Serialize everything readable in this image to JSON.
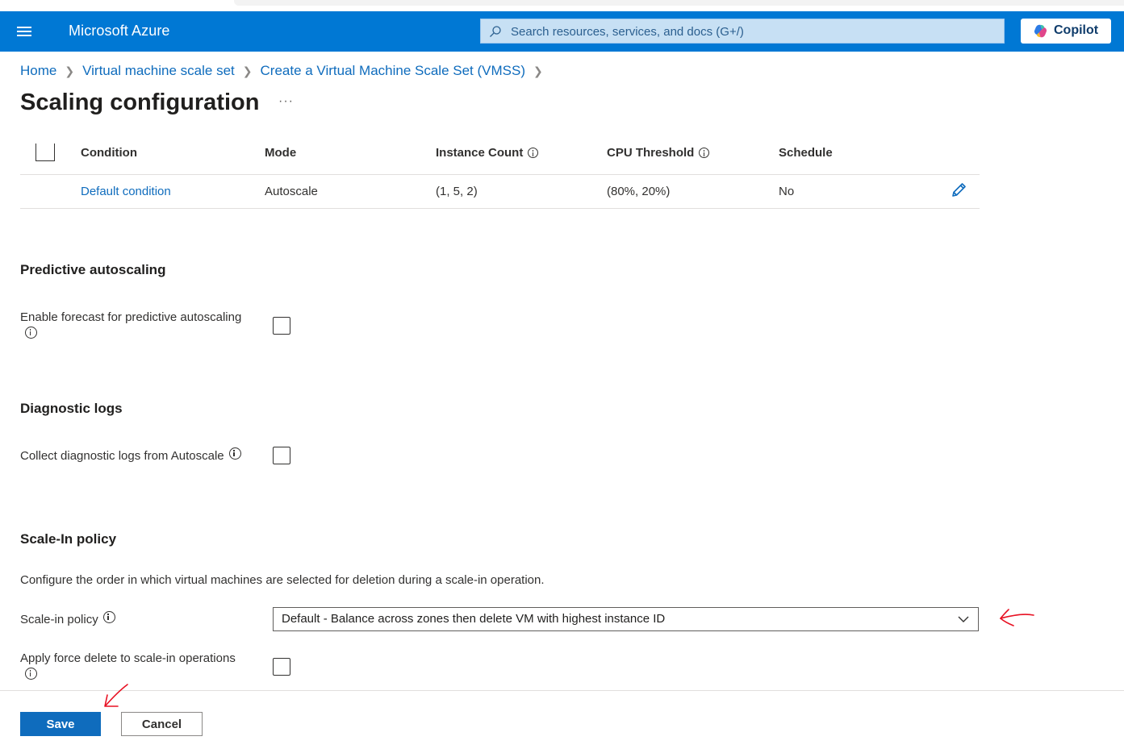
{
  "header": {
    "brand": "Microsoft Azure",
    "search_placeholder": "Search resources, services, and docs (G+/)",
    "copilot_label": "Copilot",
    "accent_color": "#0078d4"
  },
  "breadcrumb": {
    "items": [
      "Home",
      "Virtual machine scale set",
      "Create a Virtual Machine Scale Set (VMSS)"
    ]
  },
  "page": {
    "title": "Scaling configuration",
    "more_label": "···"
  },
  "conditions_table": {
    "columns": [
      "Condition",
      "Mode",
      "Instance Count",
      "CPU Threshold",
      "Schedule"
    ],
    "rows": [
      {
        "condition": "Default condition",
        "mode": "Autoscale",
        "instance_count": "(1, 5, 2)",
        "cpu_threshold": "(80%, 20%)",
        "schedule": "No"
      }
    ]
  },
  "predictive": {
    "heading": "Predictive autoscaling",
    "enable_forecast_label": "Enable forecast for predictive autoscaling",
    "enable_forecast_checked": false
  },
  "diagnostics": {
    "heading": "Diagnostic logs",
    "collect_label": "Collect diagnostic logs from Autoscale",
    "collect_checked": false
  },
  "scale_in": {
    "heading": "Scale-In policy",
    "description": "Configure the order in which virtual machines are selected for deletion during a scale-in operation.",
    "policy_label": "Scale-in policy",
    "policy_value": "Default - Balance across zones then delete VM with highest instance ID",
    "force_delete_label": "Apply force delete to scale-in operations",
    "force_delete_checked": false
  },
  "footer": {
    "save_label": "Save",
    "cancel_label": "Cancel"
  },
  "annotation_color": "#e81123"
}
